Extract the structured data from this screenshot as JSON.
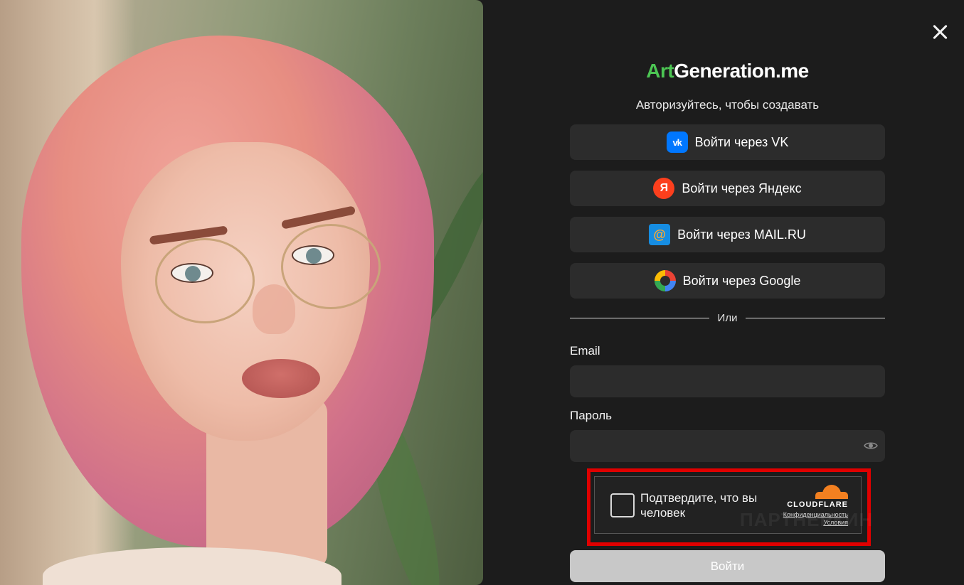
{
  "logo": {
    "accent": "Art",
    "rest": "Generation.me",
    "accent_color": "#4cc553"
  },
  "subtitle": "Авторизуйтесь, чтобы создавать",
  "oauth": [
    {
      "label": "Войти через VK",
      "icon": "vk-icon",
      "icon_text": "vk"
    },
    {
      "label": "Войти через Яндекс",
      "icon": "yandex-icon",
      "icon_text": "Я"
    },
    {
      "label": "Войти через MAIL.RU",
      "icon": "mailru-icon",
      "icon_text": "@"
    },
    {
      "label": "Войти через Google",
      "icon": "google-icon",
      "icon_text": ""
    }
  ],
  "divider": "Или",
  "email": {
    "label": "Email",
    "value": "",
    "placeholder": ""
  },
  "password": {
    "label": "Пароль",
    "value": "",
    "placeholder": ""
  },
  "captcha": {
    "text": "Подтвердите, что вы человек",
    "brand": "CLOUDFLARE",
    "privacy": "Конфиденциальность",
    "terms": "Условия",
    "highlight_color": "#e00000"
  },
  "watermark": "ПАРТНЕРКИН",
  "submit_label": "Войти"
}
